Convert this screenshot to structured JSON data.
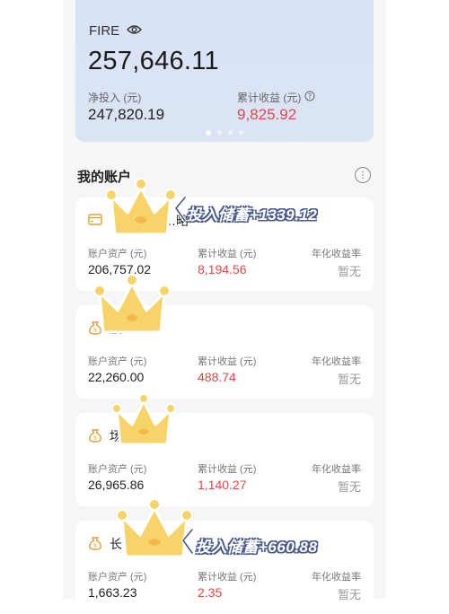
{
  "summary": {
    "label": "FIRE",
    "total": "257,646.11",
    "net_invest_label": "净投入 (元)",
    "net_invest_value": "247,820.19",
    "cum_return_label": "累计收益 (元)",
    "cum_return_value": "9,825.92"
  },
  "section": {
    "title": "我的账户"
  },
  "cards": [
    {
      "name": "…略",
      "asset_label": "账户资产 (元)",
      "asset_value": "206,757.02",
      "return_label": "累计收益 (元)",
      "return_value": "8,194.56",
      "annual_label": "年化收益率",
      "annual_value": "暂无"
    },
    {
      "name": "股",
      "asset_label": "账户资产 (元)",
      "asset_value": "22,260.00",
      "return_label": "累计收益 (元)",
      "return_value": "488.74",
      "annual_label": "年化收益率",
      "annual_value": "暂无"
    },
    {
      "name": "场…金",
      "asset_label": "账户资产 (元)",
      "asset_value": "26,965.86",
      "return_label": "累计收益 (元)",
      "return_value": "1,140.27",
      "annual_label": "年化收益率",
      "annual_value": "暂无"
    },
    {
      "name": "长…",
      "asset_label": "账户资产 (元)",
      "asset_value": "1,663.23",
      "return_label": "累计收益 (元)",
      "return_value": "2.35",
      "annual_label": "年化收益率",
      "annual_value": "暂无"
    }
  ],
  "annotations": {
    "note_1": "投入储蓄+1339.12",
    "note_2": "投入储蓄+660.88"
  },
  "colors": {
    "accent_red": "#e24a4a",
    "summary_bg": "#dbe4f5",
    "crown": "#f7d46a"
  }
}
